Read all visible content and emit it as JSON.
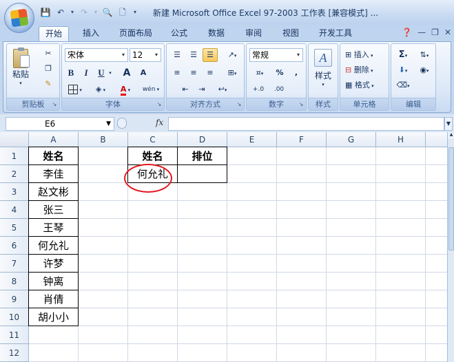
{
  "window": {
    "title": "新建 Microsoft Office Excel 97-2003 工作表 [兼容模式] ..."
  },
  "tabs": [
    "开始",
    "插入",
    "页面布局",
    "公式",
    "数据",
    "审阅",
    "视图",
    "开发工具"
  ],
  "ribbon": {
    "clipboard": {
      "label": "剪贴板",
      "paste": "粘贴"
    },
    "font": {
      "label": "字体",
      "name": "宋体",
      "size": "12",
      "bold": "B",
      "italic": "I",
      "underline": "U",
      "grow": "A",
      "shrink": "A",
      "color_letter": "A",
      "wen": "wén"
    },
    "alignment": {
      "label": "对齐方式"
    },
    "number": {
      "label": "数字",
      "format": "常规",
      "percent": "%",
      "comma": ",",
      "inc": "+.0",
      "dec": ".00"
    },
    "styles": {
      "label": "样式"
    },
    "cells": {
      "label": "单元格",
      "insert": "插入",
      "delete": "删除",
      "format": "格式"
    },
    "editing": {
      "label": "编辑",
      "sum": "Σ"
    }
  },
  "formula_bar": {
    "name_box": "E6",
    "fx": "fx",
    "content": ""
  },
  "sheet": {
    "columns": [
      "A",
      "B",
      "C",
      "D",
      "E",
      "F",
      "G",
      "H"
    ],
    "rows": [
      "1",
      "2",
      "3",
      "4",
      "5",
      "6",
      "7",
      "8",
      "9",
      "10",
      "11",
      "12"
    ],
    "col_a": [
      "姓名",
      "李佳",
      "赵文彬",
      "张三",
      "王琴",
      "何允礼",
      "许梦",
      "钟离",
      "肖倩",
      "胡小小"
    ],
    "c1": "姓名",
    "d1": "排位",
    "c2": "何允礼"
  },
  "colors": {
    "annotation": "#e3171e"
  }
}
